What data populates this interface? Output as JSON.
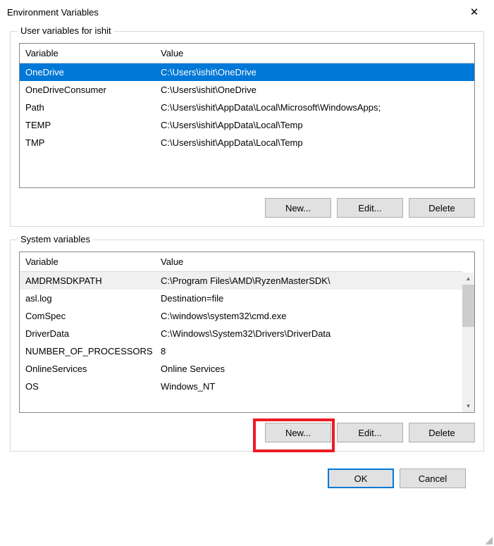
{
  "window": {
    "title": "Environment Variables"
  },
  "user_group": {
    "label": "User variables for ishit",
    "columns": {
      "var": "Variable",
      "val": "Value"
    },
    "rows": [
      {
        "var": "OneDrive",
        "val": "C:\\Users\\ishit\\OneDrive"
      },
      {
        "var": "OneDriveConsumer",
        "val": "C:\\Users\\ishit\\OneDrive"
      },
      {
        "var": "Path",
        "val": "C:\\Users\\ishit\\AppData\\Local\\Microsoft\\WindowsApps;"
      },
      {
        "var": "TEMP",
        "val": "C:\\Users\\ishit\\AppData\\Local\\Temp"
      },
      {
        "var": "TMP",
        "val": "C:\\Users\\ishit\\AppData\\Local\\Temp"
      }
    ],
    "buttons": {
      "new": "New...",
      "edit": "Edit...",
      "delete": "Delete"
    }
  },
  "system_group": {
    "label": "System variables",
    "columns": {
      "var": "Variable",
      "val": "Value"
    },
    "rows": [
      {
        "var": "AMDRMSDKPATH",
        "val": "C:\\Program Files\\AMD\\RyzenMasterSDK\\"
      },
      {
        "var": "asl.log",
        "val": "Destination=file"
      },
      {
        "var": "ComSpec",
        "val": "C:\\windows\\system32\\cmd.exe"
      },
      {
        "var": "DriverData",
        "val": "C:\\Windows\\System32\\Drivers\\DriverData"
      },
      {
        "var": "NUMBER_OF_PROCESSORS",
        "val": "8"
      },
      {
        "var": "OnlineServices",
        "val": "Online Services"
      },
      {
        "var": "OS",
        "val": "Windows_NT"
      }
    ],
    "buttons": {
      "new": "New...",
      "edit": "Edit...",
      "delete": "Delete"
    }
  },
  "footer": {
    "ok": "OK",
    "cancel": "Cancel"
  }
}
